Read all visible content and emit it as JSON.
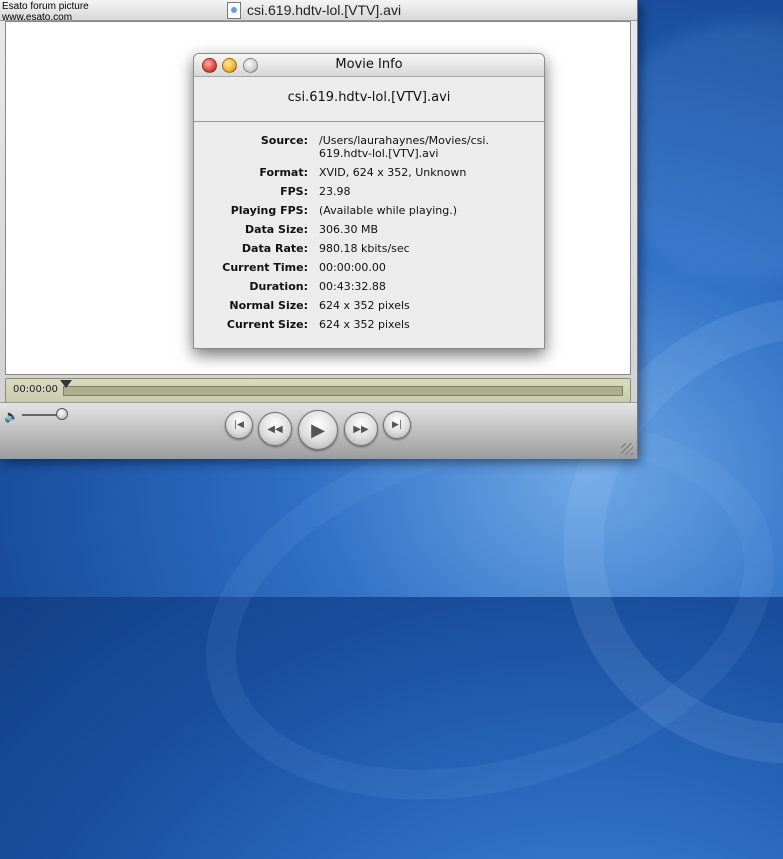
{
  "watermark": {
    "line1": "Esato forum picture",
    "line2": "www.esato.com"
  },
  "player": {
    "title": "csi.619.hdtv-lol.[VTV].avi",
    "timecode": "00:00:00",
    "progress_fraction": 0
  },
  "info": {
    "title": "Movie Info",
    "file_name": "csi.619.hdtv-lol.[VTV].avi",
    "rows": [
      {
        "label": "Source:",
        "value": "/Users/laurahaynes/Movies/csi.\n619.hdtv-lol.[VTV].avi"
      },
      {
        "label": "Format:",
        "value": "XVID, 624 x 352, Unknown"
      },
      {
        "label": "FPS:",
        "value": "23.98"
      },
      {
        "label": "Playing FPS:",
        "value": "(Available while playing.)"
      },
      {
        "label": "Data Size:",
        "value": "306.30 MB"
      },
      {
        "label": "Data Rate:",
        "value": "980.18 kbits/sec"
      },
      {
        "label": "Current Time:",
        "value": "00:00:00.00"
      },
      {
        "label": "Duration:",
        "value": "00:43:32.88"
      },
      {
        "label": "Normal Size:",
        "value": "624 x 352  pixels"
      },
      {
        "label": "Current Size:",
        "value": "624 x 352  pixels"
      }
    ]
  },
  "controls": {
    "start_glyph": "|◀",
    "rewind_glyph": "◀◀",
    "play_glyph": "▶",
    "ff_glyph": "▶▶",
    "end_glyph": "▶|",
    "volume_glyph": "🔈"
  }
}
